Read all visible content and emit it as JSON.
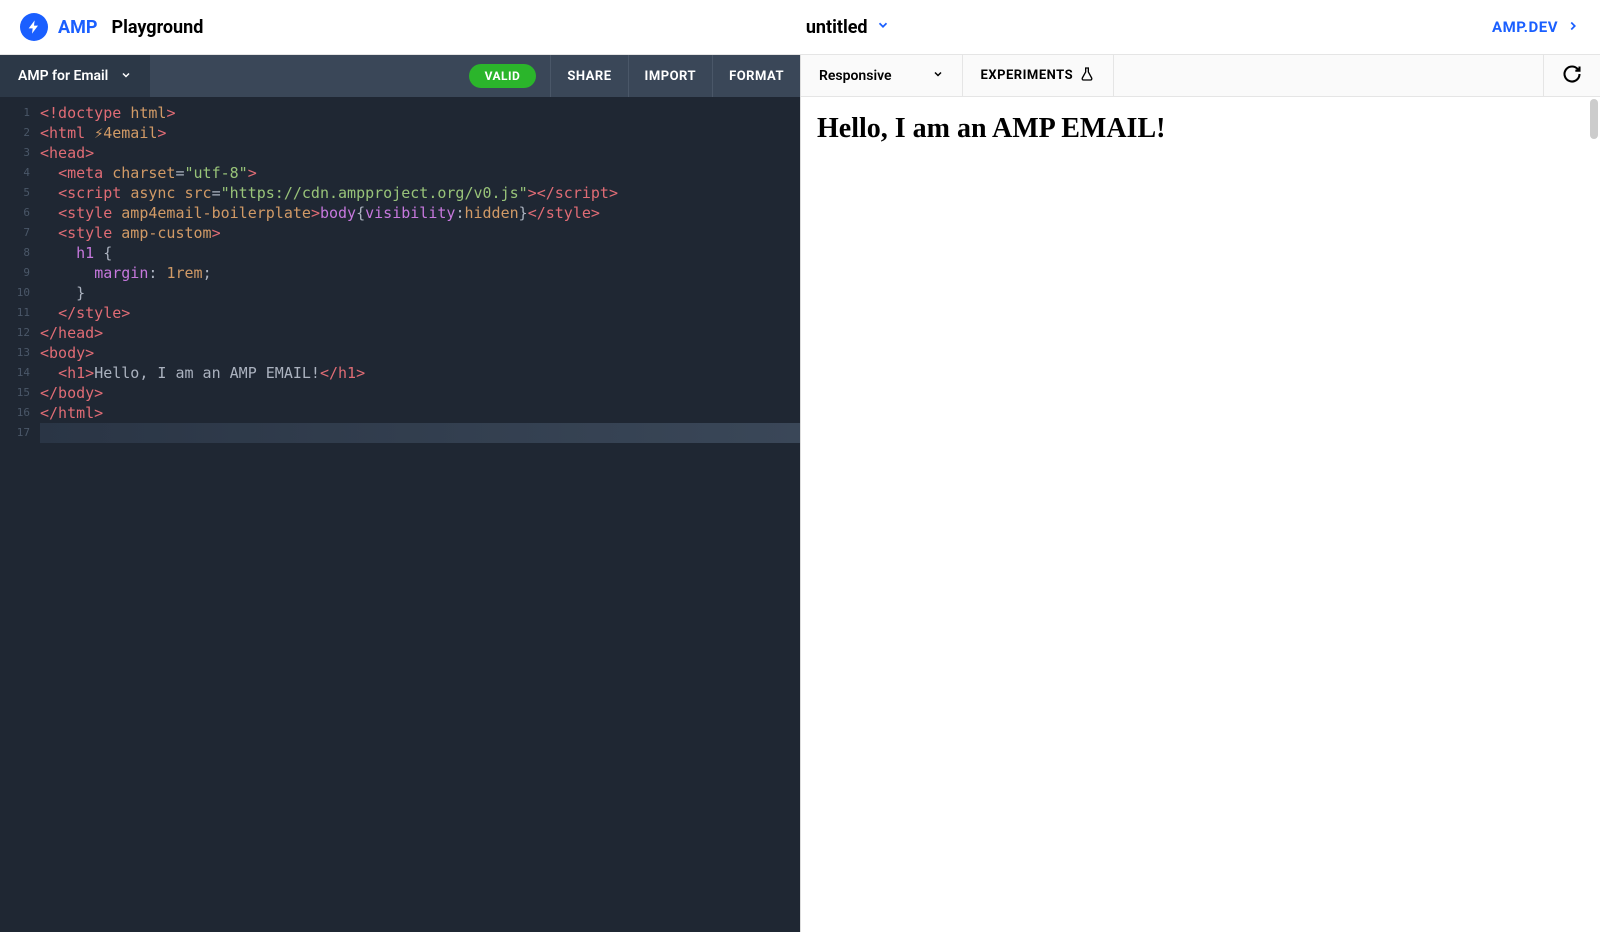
{
  "header": {
    "brand_amp": "AMP",
    "brand_playground": "Playground",
    "doc_title": "untitled",
    "amp_dev_link": "AMP.DEV"
  },
  "editor_toolbar": {
    "format_label": "AMP for Email",
    "valid_label": "VALID",
    "share_label": "SHARE",
    "import_label": "IMPORT",
    "format_btn_label": "FORMAT"
  },
  "preview_toolbar": {
    "viewport_label": "Responsive",
    "experiments_label": "EXPERIMENTS"
  },
  "preview": {
    "heading": "Hello, I am an AMP EMAIL!"
  },
  "code": {
    "lines": [
      {
        "n": "1",
        "tokens": [
          [
            "t-tag",
            "<!doctype "
          ],
          [
            "t-attr",
            "html"
          ],
          [
            "t-tag",
            ">"
          ]
        ]
      },
      {
        "n": "2",
        "tokens": [
          [
            "t-tag",
            "<html "
          ],
          [
            "t-attr",
            "⚡4email"
          ],
          [
            "t-tag",
            ">"
          ]
        ]
      },
      {
        "n": "3",
        "tokens": [
          [
            "t-tag",
            "<head>"
          ]
        ]
      },
      {
        "n": "4",
        "tokens": [
          [
            "t-text",
            "  "
          ],
          [
            "t-tag",
            "<meta "
          ],
          [
            "t-attr",
            "charset"
          ],
          [
            "t-punc",
            "="
          ],
          [
            "t-str",
            "\"utf-8\""
          ],
          [
            "t-tag",
            ">"
          ]
        ]
      },
      {
        "n": "5",
        "tokens": [
          [
            "t-text",
            "  "
          ],
          [
            "t-tag",
            "<script "
          ],
          [
            "t-attr",
            "async src"
          ],
          [
            "t-punc",
            "="
          ],
          [
            "t-str",
            "\"https://cdn.ampproject.org/v0.js\""
          ],
          [
            "t-tag",
            "></script>"
          ]
        ]
      },
      {
        "n": "6",
        "tokens": [
          [
            "t-text",
            "  "
          ],
          [
            "t-tag",
            "<style "
          ],
          [
            "t-attr",
            "amp4email-boilerplate"
          ],
          [
            "t-tag",
            ">"
          ],
          [
            "t-prop",
            "body"
          ],
          [
            "t-brace",
            "{"
          ],
          [
            "t-prop",
            "visibility"
          ],
          [
            "t-punc",
            ":"
          ],
          [
            "t-val",
            "hidden"
          ],
          [
            "t-brace",
            "}"
          ],
          [
            "t-tag",
            "</style>"
          ]
        ]
      },
      {
        "n": "7",
        "tokens": [
          [
            "t-text",
            "  "
          ],
          [
            "t-tag",
            "<style "
          ],
          [
            "t-attr",
            "amp-custom"
          ],
          [
            "t-tag",
            ">"
          ]
        ]
      },
      {
        "n": "8",
        "tokens": [
          [
            "t-text",
            "    "
          ],
          [
            "t-prop",
            "h1 "
          ],
          [
            "t-brace",
            "{"
          ]
        ]
      },
      {
        "n": "9",
        "tokens": [
          [
            "t-text",
            "      "
          ],
          [
            "t-prop",
            "margin"
          ],
          [
            "t-punc",
            ": "
          ],
          [
            "t-num",
            "1rem"
          ],
          [
            "t-punc",
            ";"
          ]
        ]
      },
      {
        "n": "10",
        "tokens": [
          [
            "t-text",
            "    "
          ],
          [
            "t-brace",
            "}"
          ]
        ]
      },
      {
        "n": "11",
        "tokens": [
          [
            "t-text",
            "  "
          ],
          [
            "t-tag",
            "</style>"
          ]
        ]
      },
      {
        "n": "12",
        "tokens": [
          [
            "t-tag",
            "</head>"
          ]
        ]
      },
      {
        "n": "13",
        "tokens": [
          [
            "t-tag",
            "<body>"
          ]
        ]
      },
      {
        "n": "14",
        "tokens": [
          [
            "t-text",
            "  "
          ],
          [
            "t-tag",
            "<h1>"
          ],
          [
            "t-text",
            "Hello, I am an AMP EMAIL!"
          ],
          [
            "t-tag",
            "</h1>"
          ]
        ]
      },
      {
        "n": "15",
        "tokens": [
          [
            "t-tag",
            "</body>"
          ]
        ]
      },
      {
        "n": "16",
        "tokens": [
          [
            "t-tag",
            "</html>"
          ]
        ]
      },
      {
        "n": "17",
        "tokens": [
          [
            "t-text",
            ""
          ]
        ],
        "active": true
      }
    ]
  }
}
